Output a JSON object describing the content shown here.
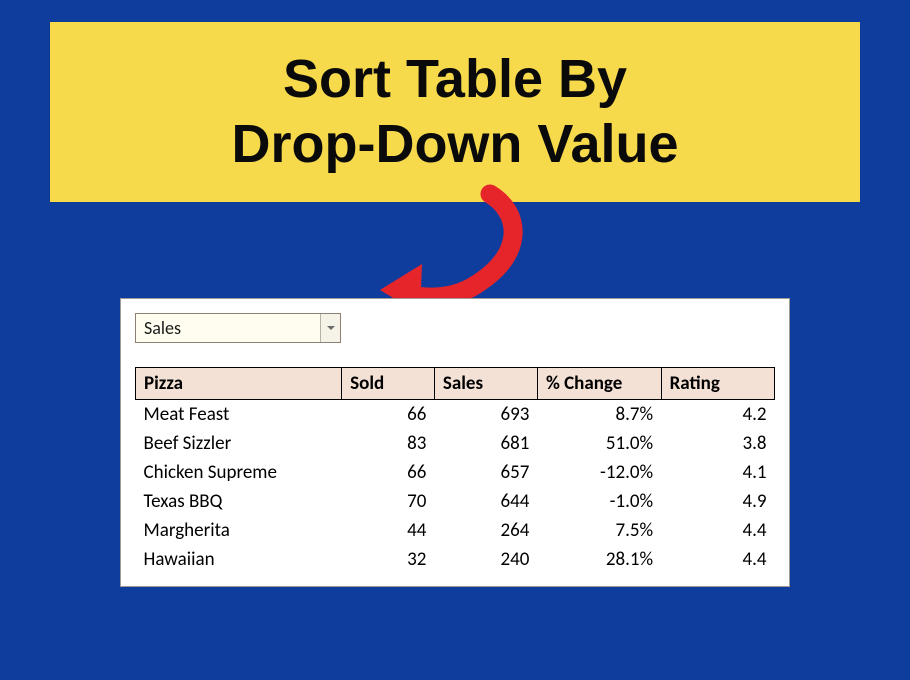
{
  "title": "Sort Table By\nDrop-Down Value",
  "dropdown": {
    "value": "Sales"
  },
  "table": {
    "headers": [
      "Pizza",
      "Sold",
      "Sales",
      "% Change",
      "Rating"
    ],
    "rows": [
      {
        "pizza": "Meat Feast",
        "sold": "66",
        "sales": "693",
        "change": "8.7%",
        "rating": "4.2"
      },
      {
        "pizza": "Beef Sizzler",
        "sold": "83",
        "sales": "681",
        "change": "51.0%",
        "rating": "3.8"
      },
      {
        "pizza": "Chicken Supreme",
        "sold": "66",
        "sales": "657",
        "change": "-12.0%",
        "rating": "4.1"
      },
      {
        "pizza": "Texas BBQ",
        "sold": "70",
        "sales": "644",
        "change": "-1.0%",
        "rating": "4.9"
      },
      {
        "pizza": "Margherita",
        "sold": "44",
        "sales": "264",
        "change": "7.5%",
        "rating": "4.4"
      },
      {
        "pizza": "Hawaiian",
        "sold": "32",
        "sales": "240",
        "change": "28.1%",
        "rating": "4.4"
      }
    ]
  },
  "chart_data": {
    "type": "table",
    "title": "Sort Table By Drop-Down Value",
    "sort_by": "Sales",
    "columns": [
      "Pizza",
      "Sold",
      "Sales",
      "% Change",
      "Rating"
    ],
    "data": [
      [
        "Meat Feast",
        66,
        693,
        8.7,
        4.2
      ],
      [
        "Beef Sizzler",
        83,
        681,
        51.0,
        3.8
      ],
      [
        "Chicken Supreme",
        66,
        657,
        -12.0,
        4.1
      ],
      [
        "Texas BBQ",
        70,
        644,
        -1.0,
        4.9
      ],
      [
        "Margherita",
        44,
        264,
        7.5,
        4.4
      ],
      [
        "Hawaiian",
        32,
        240,
        28.1,
        4.4
      ]
    ]
  },
  "colors": {
    "background": "#0f3d9e",
    "title_card": "#f7d94c",
    "arrow": "#e6252b",
    "header_fill": "#f4e1d6",
    "dropdown_fill": "#fffdef"
  }
}
